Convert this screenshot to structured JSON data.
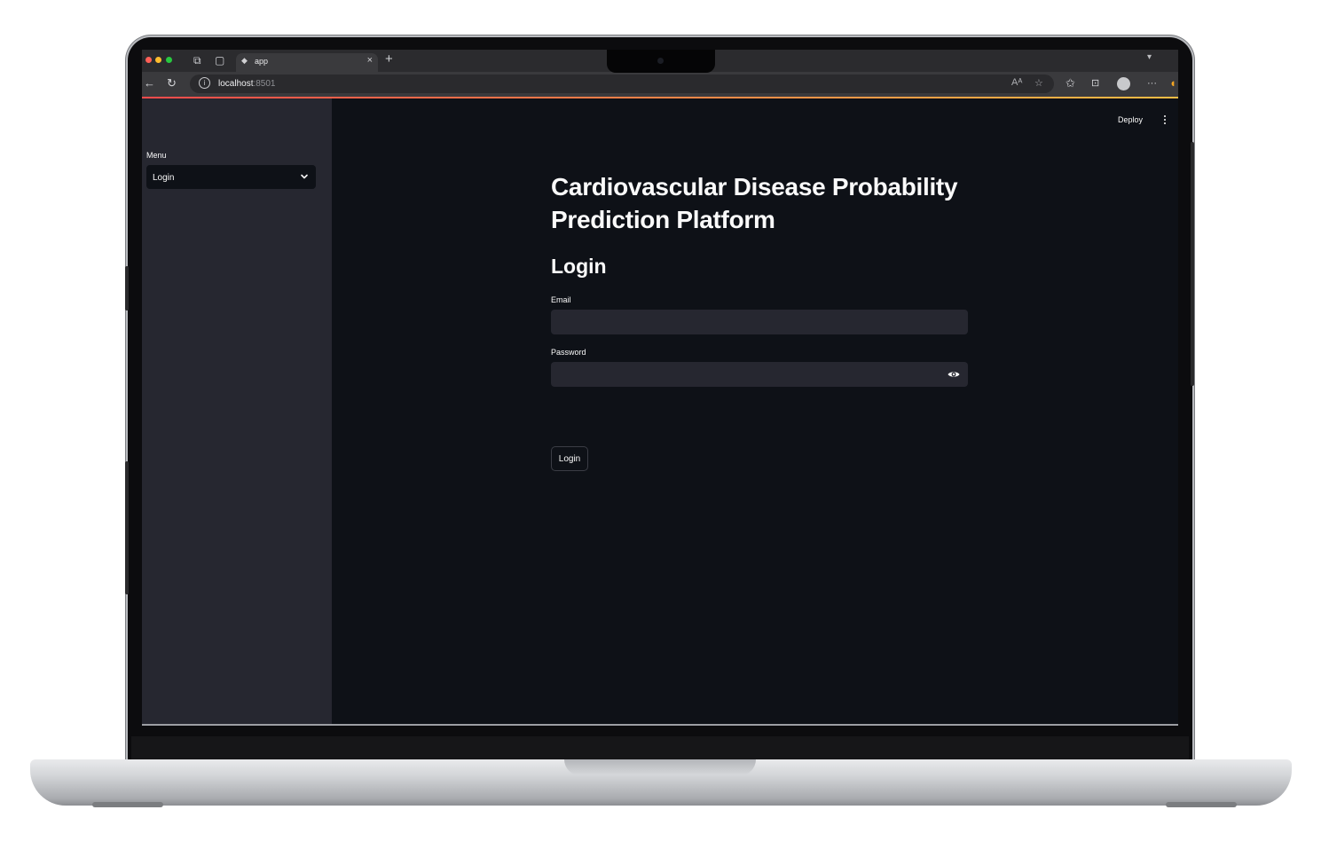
{
  "browser": {
    "tab_title": "app",
    "tab_close": "×",
    "new_tab": "+",
    "url_host": "localhost",
    "url_port": ":8501",
    "more_menu": "···"
  },
  "sidebar": {
    "menu_label": "Menu",
    "selected_page": "Login"
  },
  "header": {
    "deploy_label": "Deploy"
  },
  "main": {
    "title": "Cardiovascular Disease Probability Prediction Platform",
    "section_title": "Login",
    "email_label": "Email",
    "email_value": "",
    "password_label": "Password",
    "password_value": "",
    "login_button": "Login"
  },
  "colors": {
    "app_background": "#0e1117",
    "sidebar_background": "#262730",
    "input_background": "#262730",
    "text": "#fafafa",
    "accent_start": "#ff4b4b",
    "accent_end": "#ffbd45"
  }
}
